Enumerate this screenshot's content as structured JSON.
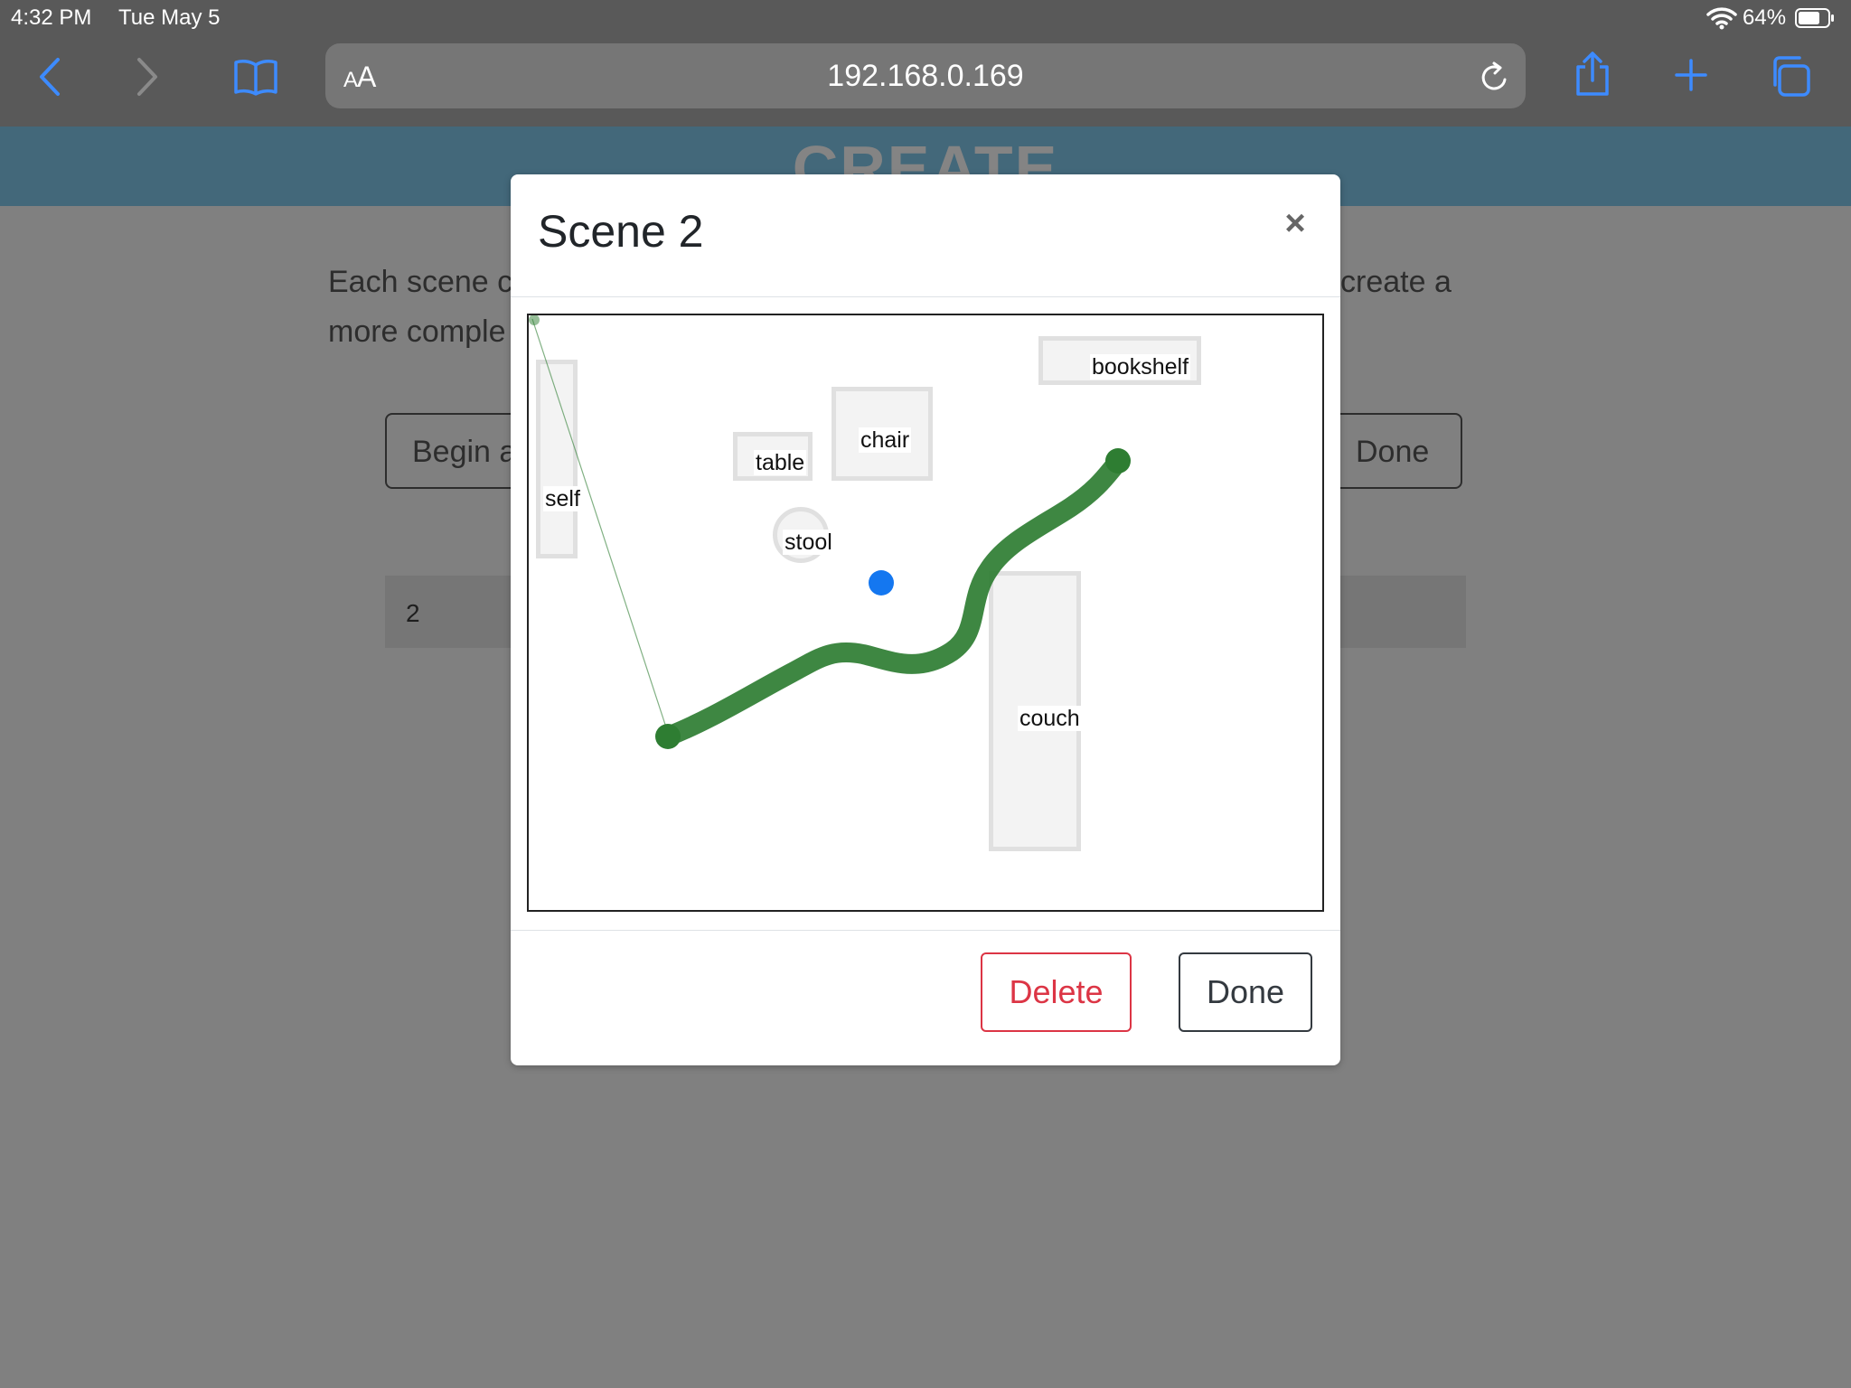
{
  "status_bar": {
    "time": "4:32 PM",
    "date": "Tue May 5",
    "battery_percent": "64%"
  },
  "browser": {
    "url": "192.168.0.169",
    "text_size_label_small": "A",
    "text_size_label_large": "A",
    "icons": [
      "back-icon",
      "forward-icon",
      "bookmarks-icon",
      "reload-icon",
      "share-icon",
      "new-tab-icon",
      "tabs-icon"
    ]
  },
  "page": {
    "header_title": "CREATE",
    "intro_line1": "Each scene c",
    "intro_line1_right": "create a",
    "intro_line2": "more comple",
    "begin_button": "Begin a",
    "done_button": "Done",
    "list_item": "2"
  },
  "modal": {
    "title": "Scene 2",
    "close_label": "×",
    "delete_label": "Delete",
    "done_label": "Done",
    "objects": [
      {
        "key": "self",
        "label": "self"
      },
      {
        "key": "table",
        "label": "table"
      },
      {
        "key": "chair",
        "label": "chair"
      },
      {
        "key": "bookshelf",
        "label": "bookshelf"
      },
      {
        "key": "stool",
        "label": "stool"
      },
      {
        "key": "couch",
        "label": "couch"
      }
    ]
  },
  "colors": {
    "path": "#2e7d32",
    "marker": "#1477f0",
    "delete": "#dc3545",
    "header": "#43687a"
  }
}
